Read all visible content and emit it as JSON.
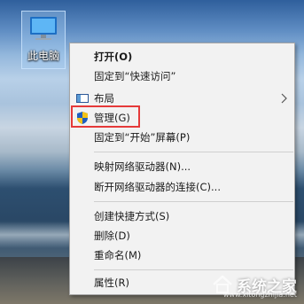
{
  "desktop": {
    "icon_label": "此电脑"
  },
  "menu": {
    "items": [
      {
        "label": "打开(O)",
        "bold": true
      },
      {
        "label": "固定到“快速访问”"
      },
      {
        "label": "布局",
        "icon": "layout-icon",
        "submenu": true
      },
      {
        "label": "管理(G)",
        "icon": "shield-icon",
        "highlighted": true
      },
      {
        "label": "固定到“开始”屏幕(P)"
      },
      {
        "label": "映射网络驱动器(N)..."
      },
      {
        "label": "断开网络驱动器的连接(C)..."
      },
      {
        "label": "创建快捷方式(S)"
      },
      {
        "label": "删除(D)"
      },
      {
        "label": "重命名(M)"
      },
      {
        "label": "属性(R)"
      }
    ]
  },
  "watermark": {
    "text": "系统之家",
    "url": "www.xitongzhijia.net"
  },
  "colors": {
    "highlight_border": "#e53a3a",
    "menu_bg": "#f2f2f2"
  }
}
